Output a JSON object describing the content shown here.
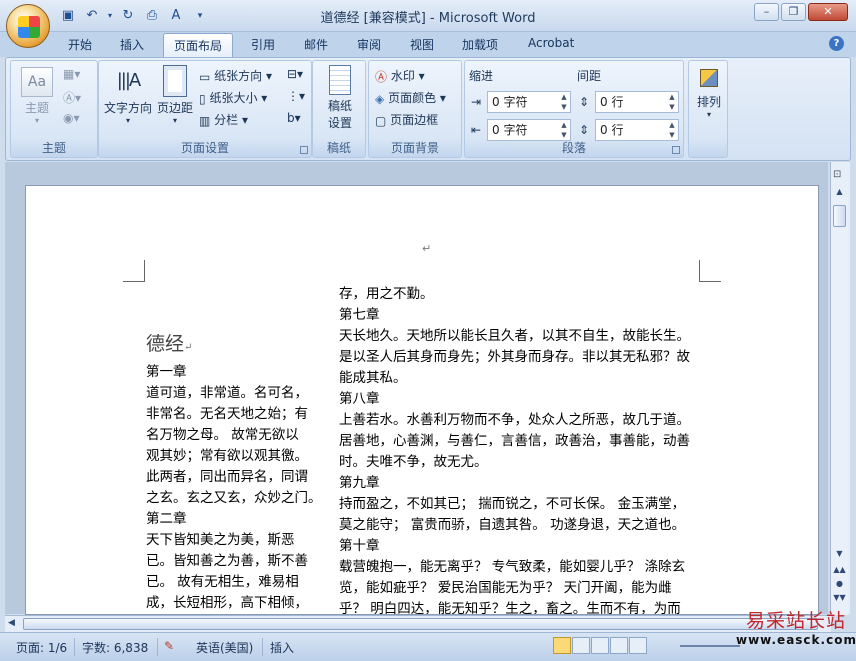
{
  "window": {
    "title": "道德经 [兼容模式] - Microsoft Word",
    "controls": [
      "minimize",
      "maximize",
      "close"
    ]
  },
  "ribbon_tabs": [
    "开始",
    "插入",
    "页面布局",
    "引用",
    "邮件",
    "审阅",
    "视图",
    "加载项",
    "Acrobat"
  ],
  "active_tab": "页面布局",
  "groups": {
    "theme": {
      "label": "主题",
      "button": "主题"
    },
    "page_setup": {
      "label": "页面设置",
      "text_direction": "文字方向",
      "margins": "页边距",
      "orientation": "纸张方向",
      "size": "纸张大小",
      "columns": "分栏"
    },
    "manuscript": {
      "label": "稿纸",
      "button": "稿纸\n设置",
      "line1": "稿纸",
      "line2": "设置"
    },
    "page_background": {
      "label": "页面背景",
      "watermark": "水印",
      "page_color": "页面颜色",
      "page_border": "页面边框"
    },
    "paragraph": {
      "label": "段落",
      "indent_label": "缩进",
      "spacing_label": "间距",
      "indent_left": "0 字符",
      "indent_right": "0 字符",
      "spacing_before": "0 行",
      "spacing_after": "0 行"
    },
    "arrange": {
      "label": "排列"
    }
  },
  "document": {
    "heading": "德经",
    "left_column": [
      "第一章",
      "道可道，非常道。名可名，",
      "非常名。无名天地之始；有",
      "名万物之母。 故常无欲以",
      "观其妙；常有欲以观其徼。",
      "此两者，同出而异名，同谓",
      "之玄。玄之又玄，众妙之门。",
      "第二章",
      "天下皆知美之为美，斯恶",
      "已。皆知善之为善，斯不善",
      "已。 故有无相生，难易相",
      "成，长短相形，高下相倾，"
    ],
    "right_column": [
      "存，用之不勤。",
      "第七章",
      "天长地久。天地所以能长且久者，以其不自生，故能长生。",
      "是以圣人后其身而身先；外其身而身存。非以其无私邪？故",
      "能成其私。",
      "第八章",
      "上善若水。水善利万物而不争，处众人之所恶，故几于道。",
      "居善地，心善渊，与善仁，言善信，政善治，事善能，动善",
      "时。夫唯不争，故无尤。",
      "第九章",
      "持而盈之，不如其已； 揣而锐之，不可长保。 金玉满堂，",
      "莫之能守； 富贵而骄，自遗其咎。 功遂身退，天之道也。",
      "第十章",
      "载营魄抱一，能无离乎？ 专气致柔，能如婴儿乎？ 涤除玄",
      "览，能如疵乎？ 爱民治国能无为乎？ 天门开阖，能为雌",
      "乎？ 明白四达，能无知乎？生之，畜之。生而不有，为而"
    ]
  },
  "status_bar": {
    "page": "页面: 1/6",
    "words": "字数: 6,838",
    "language": "英语(美国)",
    "mode": "插入"
  },
  "watermark": {
    "cn": "易采站长站",
    "en": "www.easck.com"
  },
  "colors": {
    "accent": "#c1272d",
    "ribbon": "#d4e2f3",
    "page": "#ffffff"
  }
}
